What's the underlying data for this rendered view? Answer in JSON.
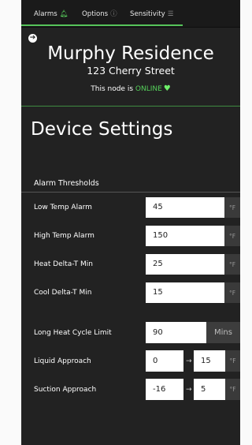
{
  "nav": {
    "tabs": [
      {
        "label": "Alarms",
        "icon": "bell-icon",
        "glyph": "🔔︎"
      },
      {
        "label": "Options",
        "icon": "help-circle-icon",
        "glyph": "ⓘ"
      },
      {
        "label": "Sensitivity",
        "icon": "sliders-icon",
        "glyph": "☰"
      }
    ],
    "active_color": "#56c35a"
  },
  "header": {
    "back_glyph": "➔",
    "title": "Murphy Residence",
    "address": "123 Cherry Street",
    "status_prefix": "This node is ",
    "status_value": "ONLINE",
    "status_icon": "heart-icon",
    "heart_glyph": "♥",
    "status_color": "#55d05a"
  },
  "page": {
    "title": "Device Settings"
  },
  "alarm_thresholds": {
    "heading": "Alarm Thresholds",
    "rows": [
      {
        "label": "Low Temp Alarm",
        "value": "45",
        "unit": "°F"
      },
      {
        "label": "High Temp Alarm",
        "value": "150",
        "unit": "°F"
      },
      {
        "label": "Heat Delta-T Min",
        "value": "25",
        "unit": "°F"
      },
      {
        "label": "Cool Delta-T Min",
        "value": "15",
        "unit": "°F"
      }
    ],
    "long_heat": {
      "label": "Long Heat Cycle Limit",
      "value": "90",
      "unit": "Mins"
    },
    "approaches": [
      {
        "label": "Liquid Approach",
        "from": "0",
        "arrow": "→",
        "to": "15",
        "unit": "°F"
      },
      {
        "label": "Suction Approach",
        "from": "-16",
        "arrow": "→",
        "to": "5",
        "unit": "°F"
      }
    ]
  }
}
